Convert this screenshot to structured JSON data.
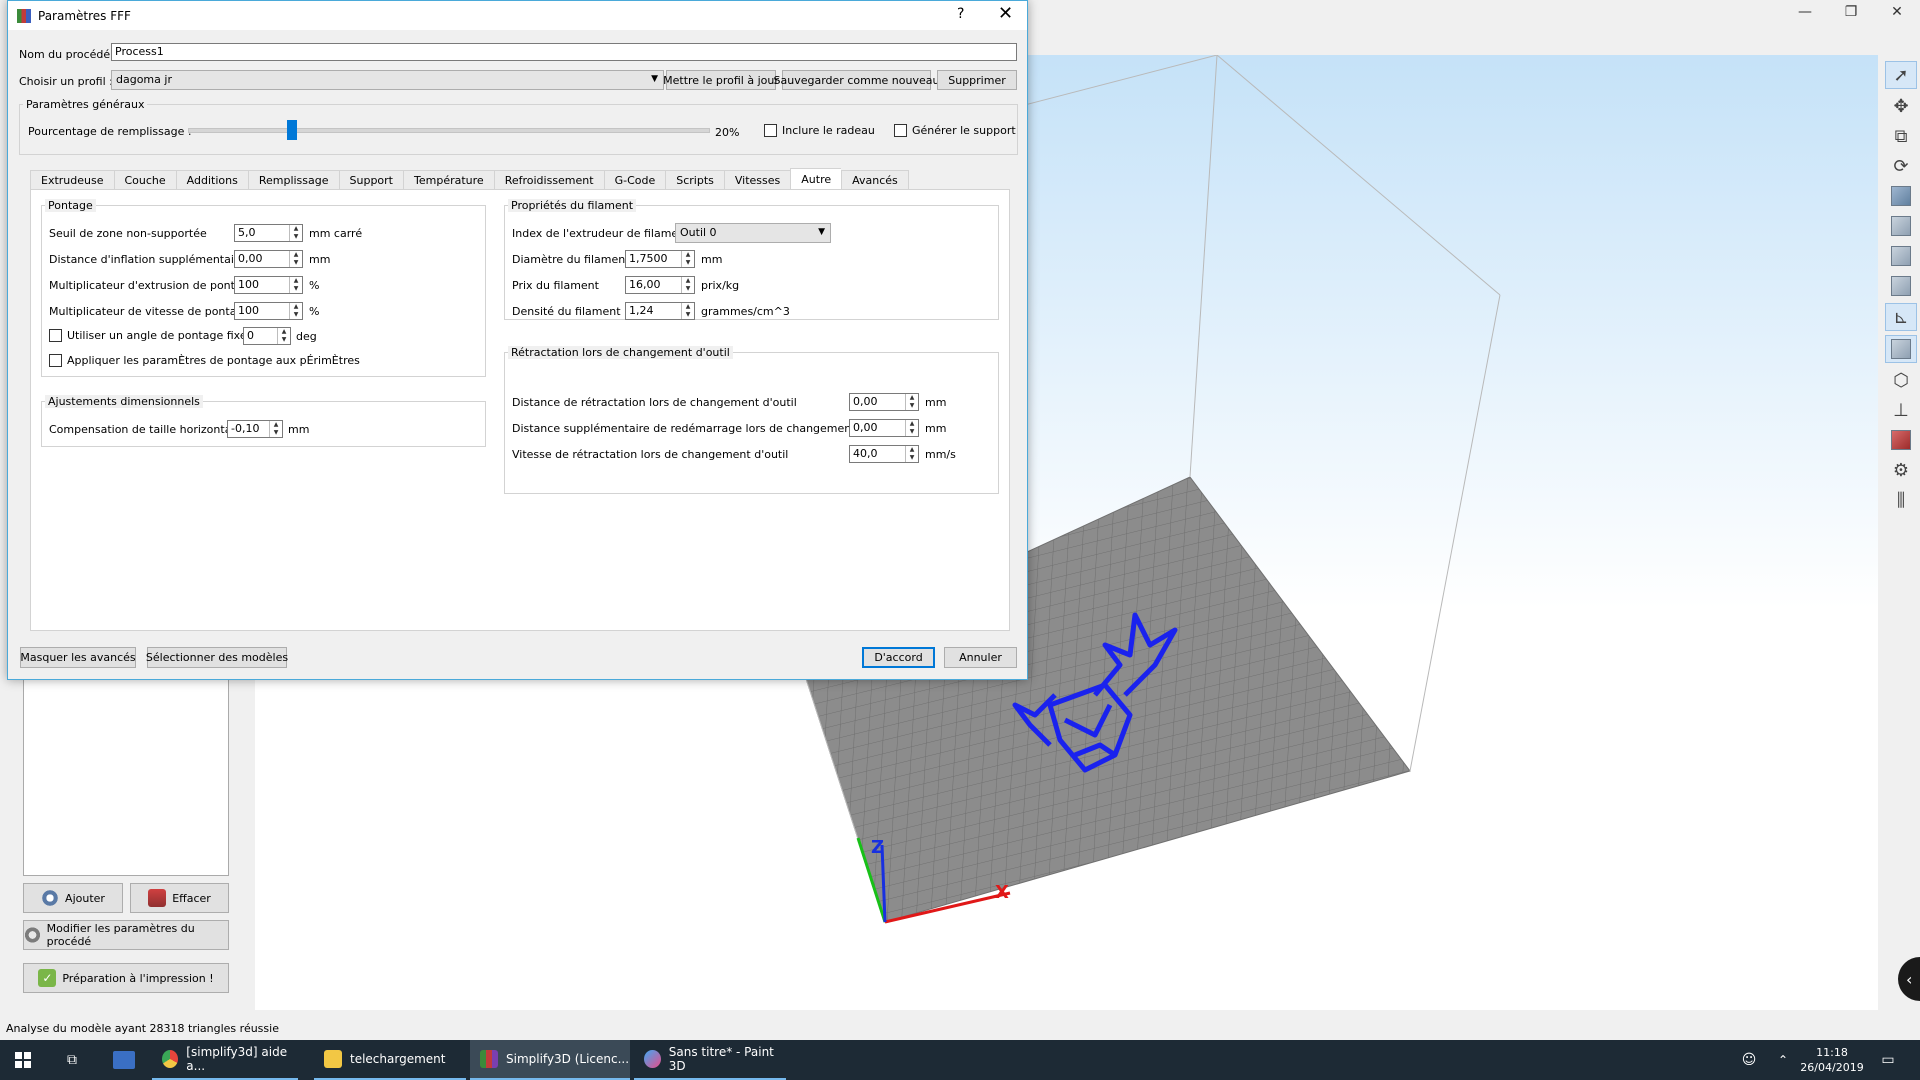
{
  "dialog": {
    "title": "Paramètres FFF",
    "help": "?",
    "close": "✕",
    "process_name_label": "Nom du procédé :",
    "process_name_value": "Process1",
    "profile_label": "Choisir un profil :",
    "profile_value": "dagoma jr",
    "update_profile_button": "Mettre le profil à jour",
    "save_new_button": "Sauvegarder comme nouveau",
    "delete_button": "Supprimer",
    "general": {
      "title": "Paramètres généraux",
      "infill_label": "Pourcentage de remplissage :",
      "infill_value": "20%",
      "infill_fraction": 0.2,
      "raft_label": "Inclure le radeau",
      "support_label": "Générer le support"
    },
    "tabs": [
      "Extrudeuse",
      "Couche",
      "Additions",
      "Remplissage",
      "Support",
      "Température",
      "Refroidissement",
      "G-Code",
      "Scripts",
      "Vitesses",
      "Autre",
      "Avancés"
    ],
    "active_tab": "Autre",
    "bridging": {
      "title": "Pontage",
      "rows": [
        {
          "label": "Seuil de zone non-supportée",
          "value": "5,0",
          "unit": "mm carré"
        },
        {
          "label": "Distance d'inflation supplémentaire",
          "value": "0,00",
          "unit": "mm"
        },
        {
          "label": "Multiplicateur d'extrusion de pontage",
          "value": "100",
          "unit": "%"
        },
        {
          "label": "Multiplicateur de vitesse de pontage",
          "value": "100",
          "unit": "%"
        }
      ],
      "fixed_angle_label": "Utiliser un angle de pontage fixe.",
      "fixed_angle_value": "0",
      "fixed_angle_unit": "deg",
      "apply_perimeters_label": "Appliquer les paramÈtres de pontage aux pÉrimÈtres"
    },
    "dimensional": {
      "title": "Ajustements dimensionnels",
      "label": "Compensation de taille horizontale",
      "value": "-0,10",
      "unit": "mm"
    },
    "filament": {
      "title": "Propriétés du filament",
      "extruder_label": "Index de l'extrudeur de filament",
      "extruder_value": "Outil 0",
      "rows": [
        {
          "label": "Diamètre du filament",
          "value": "1,7500",
          "unit": "mm"
        },
        {
          "label": "Prix du filament",
          "value": "16,00",
          "unit": "prix/kg"
        },
        {
          "label": "Densité du filament",
          "value": "1,24",
          "unit": "grammes/cm^3"
        }
      ]
    },
    "toolchange": {
      "title": "Rétractation lors de changement d'outil",
      "rows": [
        {
          "label": "Distance de rétractation lors de changement d'outil",
          "value": "0,00",
          "unit": "mm"
        },
        {
          "label": "Distance supplémentaire de redémarrage lors de changement d'outil",
          "value": "0,00",
          "unit": "mm"
        },
        {
          "label": "Vitesse de rétractation lors de changement d'outil",
          "value": "40,0",
          "unit": "mm/s"
        }
      ]
    },
    "hide_advanced_button": "Masquer les avancés",
    "select_models_button": "Sélectionner des modèles",
    "ok_button": "D'accord",
    "cancel_button": "Annuler"
  },
  "app": {
    "add_button": "Ajouter",
    "clear_button": "Effacer",
    "edit_process_button": "Modifier les paramètres du procédé",
    "prepare_button": "Préparation à l'impression !",
    "status": "Analyse du modèle ayant 28318 triangles réussie",
    "axis_z": "Z",
    "axis_x": "X",
    "window_controls": [
      "—",
      "❐",
      "✕"
    ]
  },
  "taskbar": {
    "apps": [
      {
        "label": "[simplify3d] aide a...",
        "color": "#e8453c"
      },
      {
        "label": "telechargement",
        "color": "#f2c744"
      },
      {
        "label": "Simplify3D (Licenc...",
        "color": "#7a3fb0"
      },
      {
        "label": "Sans titre* - Paint 3D",
        "color": "#3fa9f5"
      }
    ],
    "time": "11:18",
    "date": "26/04/2019"
  },
  "icons": {
    "start": "windows-logo-icon",
    "task_view": "task-view-icon",
    "people": "people-icon",
    "tray_up": "chevron-up-icon",
    "notifications": "notification-icon"
  }
}
